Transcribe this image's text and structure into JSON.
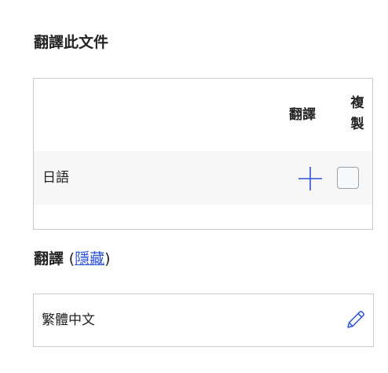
{
  "translate_section": {
    "title": "翻譯此文件",
    "table": {
      "header_translate": "翻譯",
      "header_copy": "複製",
      "rows": [
        {
          "language": "日語",
          "add_icon": "plus-icon",
          "copy_checked": false
        }
      ]
    }
  },
  "translations_section": {
    "title": "翻譯",
    "open_paren": "(",
    "hide_link": "隱藏",
    "close_paren": ")",
    "items": [
      {
        "label": "繁體中文",
        "edit_icon": "pencil-icon"
      }
    ]
  },
  "colors": {
    "accent": "#2b52d6",
    "border": "#cccccc",
    "row_bg": "#f7f7f7"
  }
}
